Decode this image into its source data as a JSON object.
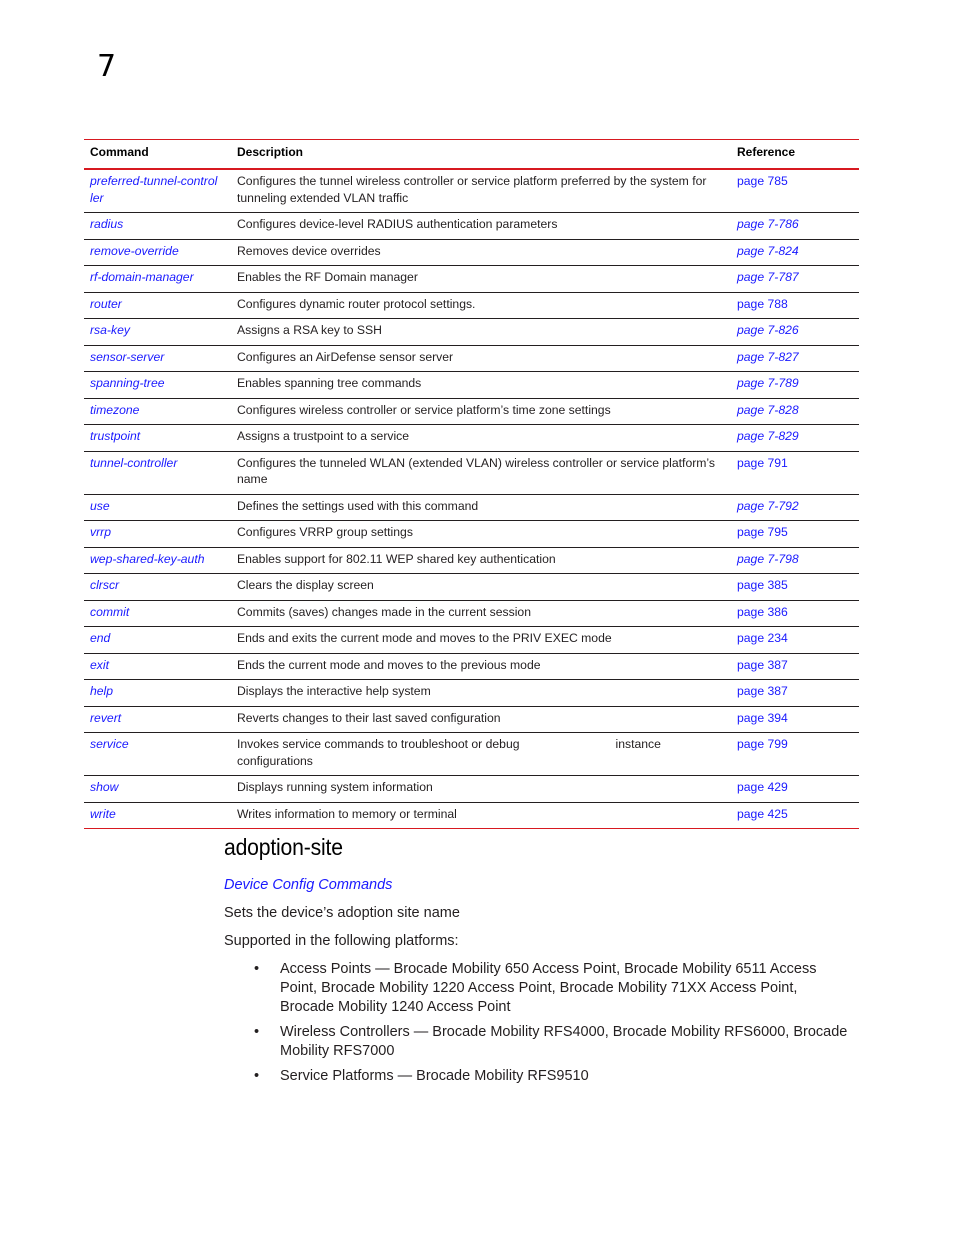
{
  "chapter_number": "7",
  "table": {
    "headers": [
      "Command",
      "Description",
      "Reference"
    ],
    "rows": [
      {
        "command": "preferred-tunnel-control ler",
        "description": "Configures the tunnel wireless controller or service platform preferred by the system for tunneling extended VLAN traffic",
        "reference": "page 785",
        "ref_italic": false
      },
      {
        "command": "radius",
        "description": "Configures device-level RADIUS authentication parameters",
        "reference": "page 7-786",
        "ref_italic": true
      },
      {
        "command": "remove-override",
        "description": "Removes device overrides",
        "reference": "page 7-824",
        "ref_italic": true
      },
      {
        "command": "rf-domain-manager",
        "description": "Enables the RF Domain manager",
        "reference": "page 7-787",
        "ref_italic": true
      },
      {
        "command": "router",
        "description": "Configures dynamic router protocol settings.",
        "reference": "page 788",
        "ref_italic": false
      },
      {
        "command": "rsa-key",
        "description": "Assigns a RSA key to SSH",
        "reference": "page 7-826",
        "ref_italic": true
      },
      {
        "command": "sensor-server",
        "description": "Configures an AirDefense sensor server",
        "reference": "page 7-827",
        "ref_italic": true
      },
      {
        "command": "spanning-tree",
        "description": "Enables spanning tree commands",
        "reference": "page 7-789",
        "ref_italic": true
      },
      {
        "command": "timezone",
        "description": "Configures wireless controller or service platform’s time zone settings",
        "reference": "page 7-828",
        "ref_italic": true
      },
      {
        "command": "trustpoint",
        "description": "Assigns a trustpoint to a service",
        "reference": "page 7-829",
        "ref_italic": true
      },
      {
        "command": "tunnel-controller",
        "description": "Configures the tunneled WLAN (extended VLAN) wireless controller or service platform’s name",
        "reference": "page 791",
        "ref_italic": false
      },
      {
        "command": "use",
        "description": "Defines the settings used with this command",
        "reference": "page 7-792",
        "ref_italic": true
      },
      {
        "command": "vrrp",
        "description": "Configures VRRP group settings",
        "reference": "page 795",
        "ref_italic": false
      },
      {
        "command": "wep-shared-key-auth",
        "description": "Enables support for 802.11 WEP shared key authentication",
        "reference": "page 7-798",
        "ref_italic": true
      },
      {
        "command": "clrscr",
        "description": "Clears the display screen",
        "reference": "page 385",
        "ref_italic": false
      },
      {
        "command": "commit",
        "description": "Commits (saves) changes made in the current session",
        "reference": "page 386",
        "ref_italic": false
      },
      {
        "command": "end",
        "description": "Ends and exits the current mode and moves to the PRIV EXEC mode",
        "reference": "page 234",
        "ref_italic": false
      },
      {
        "command": "exit",
        "description": "Ends the current mode and moves to the previous mode",
        "reference": "page 387",
        "ref_italic": false
      },
      {
        "command": "help",
        "description": "Displays the interactive help system",
        "reference": "page 387",
        "ref_italic": false
      },
      {
        "command": "revert",
        "description": "Reverts changes to their last saved configuration",
        "reference": "page 394",
        "ref_italic": false
      },
      {
        "command": "service",
        "description": "Invokes service commands to troubleshoot or debug",
        "description_extra": "instance",
        "description_line2": "configurations",
        "reference": "page 799",
        "ref_italic": false
      },
      {
        "command": "show",
        "description": "Displays running system information",
        "reference": "page 429",
        "ref_italic": false
      },
      {
        "command": "write",
        "description": "Writes information to memory or terminal",
        "reference": "page 425",
        "ref_italic": false
      }
    ]
  },
  "section": {
    "title": "adoption-site",
    "parent_link": "Device Config Commands",
    "summary": "Sets the device’s adoption site name",
    "platforms_intro": "Supported in the following platforms:",
    "platforms": [
      "Access Points — Brocade Mobility 650 Access Point, Brocade Mobility 6511 Access Point, Brocade Mobility 1220 Access Point, Brocade Mobility 71XX Access Point, Brocade Mobility 1240 Access Point",
      "Wireless Controllers — Brocade Mobility RFS4000, Brocade Mobility RFS6000, Brocade Mobility RFS7000",
      "Service Platforms — Brocade Mobility RFS9510"
    ],
    "bullet_glyph": "•"
  }
}
